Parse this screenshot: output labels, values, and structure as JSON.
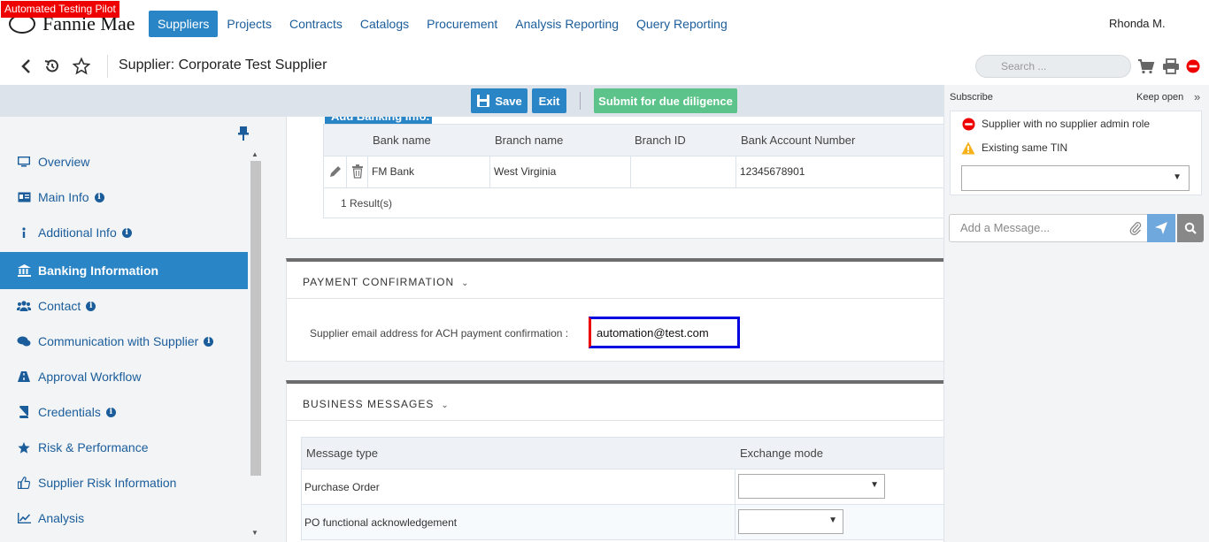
{
  "badge": "Automated Testing Pilot",
  "brand": "Fannie Mae",
  "nav": {
    "items": [
      "Suppliers",
      "Projects",
      "Contracts",
      "Catalogs",
      "Procurement",
      "Analysis Reporting",
      "Query Reporting"
    ],
    "active": "Suppliers"
  },
  "user": "Rhonda M.",
  "page_title": "Supplier: Corporate Test Supplier",
  "search_placeholder": "Search ...",
  "actions": {
    "save": "Save",
    "exit": "Exit",
    "submit": "Submit for due diligence"
  },
  "sidebar": {
    "items": [
      {
        "label": "Overview",
        "icon": "monitor-icon"
      },
      {
        "label": "Main Info",
        "icon": "id-card-icon",
        "info": true
      },
      {
        "label": "Additional Info",
        "icon": "info-icon",
        "info": true
      },
      {
        "label": "Banking Information",
        "icon": "bank-icon",
        "active": true
      },
      {
        "label": "Contact",
        "icon": "users-icon",
        "info": true
      },
      {
        "label": "Communication with Supplier",
        "icon": "chat-icon",
        "info": true
      },
      {
        "label": "Approval Workflow",
        "icon": "road-icon"
      },
      {
        "label": "Credentials",
        "icon": "book-icon",
        "info": true
      },
      {
        "label": "Risk & Performance",
        "icon": "star-icon"
      },
      {
        "label": "Supplier Risk Information",
        "icon": "thumbs-up-icon"
      },
      {
        "label": "Analysis",
        "icon": "line-chart-icon"
      }
    ]
  },
  "banking": {
    "add_button": "Add Banking Info.",
    "columns": [
      "Bank name",
      "Branch name",
      "Branch ID",
      "Bank Account Number"
    ],
    "rows": [
      {
        "bank_name": "FM Bank",
        "branch_name": "West Virginia",
        "branch_id": "",
        "account_number": "12345678901"
      }
    ],
    "result_count": "1 Result(s)"
  },
  "payment_confirmation": {
    "title": "PAYMENT CONFIRMATION",
    "label": "Supplier email address for ACH payment confirmation :",
    "value": "automation@test.com"
  },
  "business_messages": {
    "title": "BUSINESS MESSAGES",
    "columns": [
      "Message type",
      "Exchange mode"
    ],
    "rows": [
      {
        "type": "Purchase Order",
        "mode": ""
      },
      {
        "type": "PO functional acknowledgement",
        "mode": ""
      }
    ]
  },
  "right_panel": {
    "subscribe": "Subscribe",
    "keep_open": "Keep open",
    "alerts": [
      {
        "text": "Supplier with no supplier admin role",
        "level": "error"
      },
      {
        "text": "Existing same TIN",
        "level": "warning"
      }
    ],
    "message_placeholder": "Add a Message..."
  },
  "colors": {
    "primary": "#2a85c6",
    "submit": "#5cc48b",
    "alert": "#e00000"
  }
}
